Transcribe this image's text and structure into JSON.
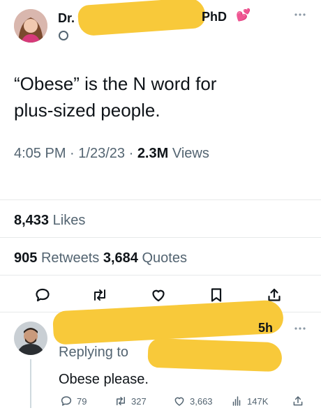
{
  "tweet": {
    "author": {
      "name_prefix": "Dr.",
      "name_suffix": "PhD",
      "heart_emoji": "💕"
    },
    "more_icon": "more-icon",
    "text_lines": [
      "“Obese” is the N word for",
      "plus-sized people."
    ],
    "time": "4:05 PM",
    "date": "1/23/23",
    "separator": "·",
    "views_count": "2.3M",
    "views_label": "Views",
    "likes_count": "8,433",
    "likes_label": "Likes",
    "retweets_count": "905",
    "retweets_label": "Retweets",
    "quotes_count": "3,684",
    "quotes_label": "Quotes",
    "actions": [
      "reply-icon",
      "retweet-icon",
      "like-icon",
      "bookmark-icon",
      "share-icon"
    ]
  },
  "reply": {
    "time_ago": "5h",
    "replying_to_label": "Replying to",
    "text": "Obese please.",
    "stats": {
      "replies": "79",
      "retweets": "327",
      "likes": "3,663",
      "views": "147K"
    }
  },
  "colors": {
    "text": "#0f1419",
    "muted": "#536471",
    "accent": "#1d9bf0",
    "redaction": "#f8c93a"
  }
}
